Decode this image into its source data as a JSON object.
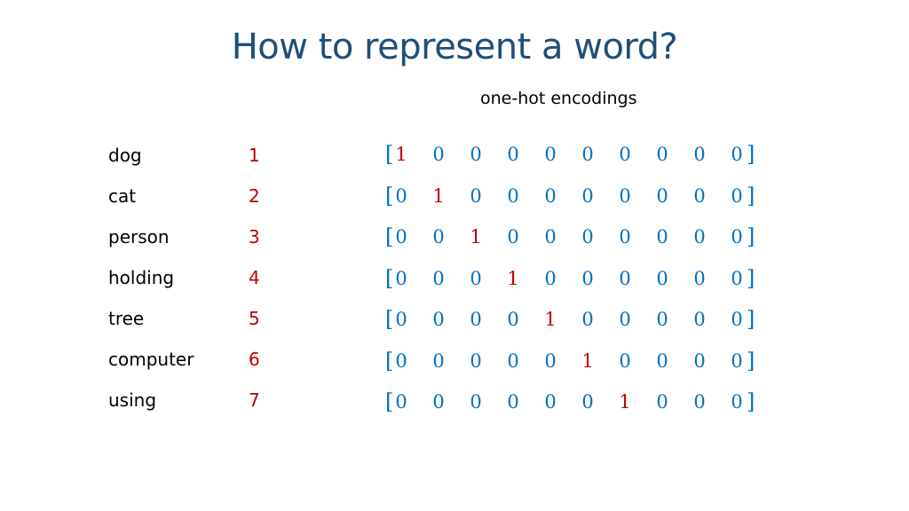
{
  "slide": {
    "title": "How to represent a word?",
    "subtitle": "one-hot encodings"
  },
  "colors": {
    "title": "#1f4e79",
    "index": "#c00000",
    "vector": "#0070c0",
    "hot": "#c00000"
  },
  "vocabulary": [
    {
      "word": "dog",
      "index": "1"
    },
    {
      "word": "cat",
      "index": "2"
    },
    {
      "word": "person",
      "index": "3"
    },
    {
      "word": "holding",
      "index": "4"
    },
    {
      "word": "tree",
      "index": "5"
    },
    {
      "word": "computer",
      "index": "6"
    },
    {
      "word": "using",
      "index": "7"
    }
  ],
  "encoding": {
    "open_bracket": "[",
    "close_bracket": "]",
    "vectors": [
      [
        1,
        0,
        0,
        0,
        0,
        0,
        0,
        0,
        0,
        0
      ],
      [
        0,
        1,
        0,
        0,
        0,
        0,
        0,
        0,
        0,
        0
      ],
      [
        0,
        0,
        1,
        0,
        0,
        0,
        0,
        0,
        0,
        0
      ],
      [
        0,
        0,
        0,
        1,
        0,
        0,
        0,
        0,
        0,
        0
      ],
      [
        0,
        0,
        0,
        0,
        1,
        0,
        0,
        0,
        0,
        0
      ],
      [
        0,
        0,
        0,
        0,
        0,
        1,
        0,
        0,
        0,
        0
      ],
      [
        0,
        0,
        0,
        0,
        0,
        0,
        1,
        0,
        0,
        0
      ]
    ]
  }
}
